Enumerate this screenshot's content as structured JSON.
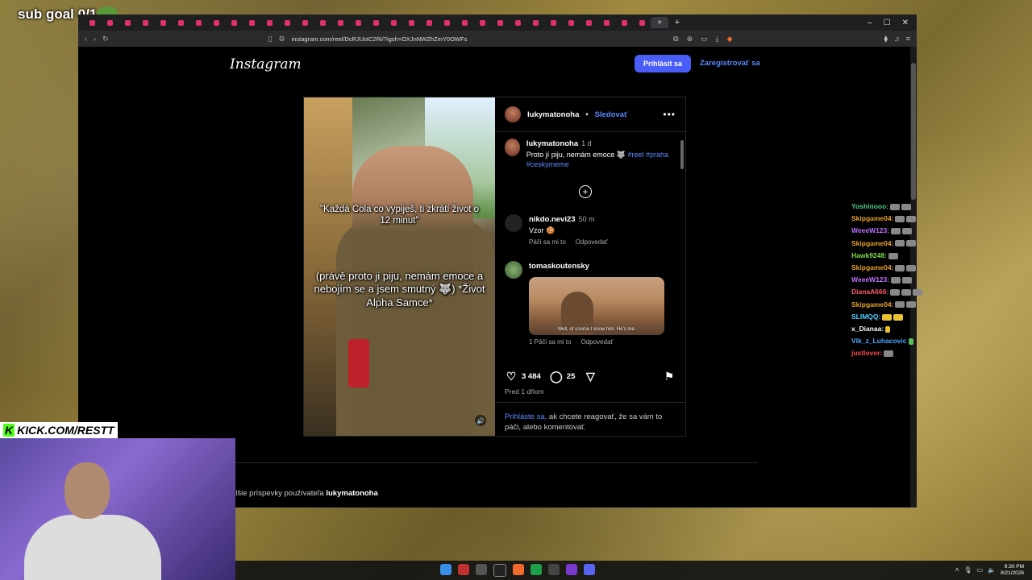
{
  "overlay": {
    "sub_goal": "sub goal 0/1",
    "kick_url": "KICK.COM/RESTT"
  },
  "browser": {
    "url": "instagram.com/reel/DcRJUstC2Ri/?igsh=OXJnNWZhZmY0OWFs",
    "tab_count": 33
  },
  "instagram": {
    "logo": "Instagram",
    "login_button": "Prihlásit sa",
    "signup_link": "Zaregistrovať sa",
    "post": {
      "author": "lukymatonoha",
      "follow": "Sledovať",
      "video_caption_top": "\"Každá Cola co vypiješ, ti zkrátí život o 12 minut\"",
      "video_caption_bottom": "(právě proto ji piju, nemám emoce a nebojím se a jsem smutný 🐺) *Život Alpha Samce*",
      "description": {
        "user": "lukymatonoha",
        "time": "1 d",
        "text": "Proto jí piju, nemám emoce 🐺 ",
        "tags": "#reel #praha #ceskymeme"
      },
      "comments": [
        {
          "user": "nikdo.nevi23",
          "time": "50 m",
          "text": "Vzor 🍪",
          "likes": "Páči sa mi to",
          "reply": "Odpovedať"
        },
        {
          "user": "tomaskoutensky",
          "time": "",
          "gif_subtitle": "Well, of course I know him. He's me.",
          "likes": "1 Páči sa mi to",
          "reply": "Odpovedať"
        }
      ],
      "like_count": "3 484",
      "comment_count": "25",
      "posted": "Pred 1 dňom",
      "login_prompt_link": "Prihláste sa,",
      "login_prompt_text": " ak chcete reagovať, že sa vám to páči, alebo komentovať."
    },
    "more_posts_prefix": "alšie príspevky používateľa ",
    "more_posts_user": "lukymatonoha"
  },
  "chat": [
    {
      "user": "Yoshinooo:",
      "color": "#4ad08a"
    },
    {
      "user": "Skipgame04:",
      "color": "#e8a030"
    },
    {
      "user": "WeeeW123:",
      "color": "#c070ff"
    },
    {
      "user": "Skipgame04:",
      "color": "#e8a030"
    },
    {
      "user": "Hawk9248:",
      "color": "#7fe04a"
    },
    {
      "user": "Skipgame04:",
      "color": "#e8a030"
    },
    {
      "user": "WeeeW123:",
      "color": "#c070ff"
    },
    {
      "user": "DianaA666:",
      "color": "#ff5a6a"
    },
    {
      "user": "Skipgame04:",
      "color": "#e8a030"
    },
    {
      "user": "SLIMQQ:",
      "color": "#4ad0ff"
    },
    {
      "user": "x_Dianaa:",
      "color": "#ffffff"
    },
    {
      "user": "Vlk_z_Luhacovic",
      "color": "#4aa8ff"
    },
    {
      "user": "justlover:",
      "color": "#ff4a4a"
    }
  ],
  "taskbar": {
    "time": "9:30 PM",
    "date": "8/21/2026"
  }
}
